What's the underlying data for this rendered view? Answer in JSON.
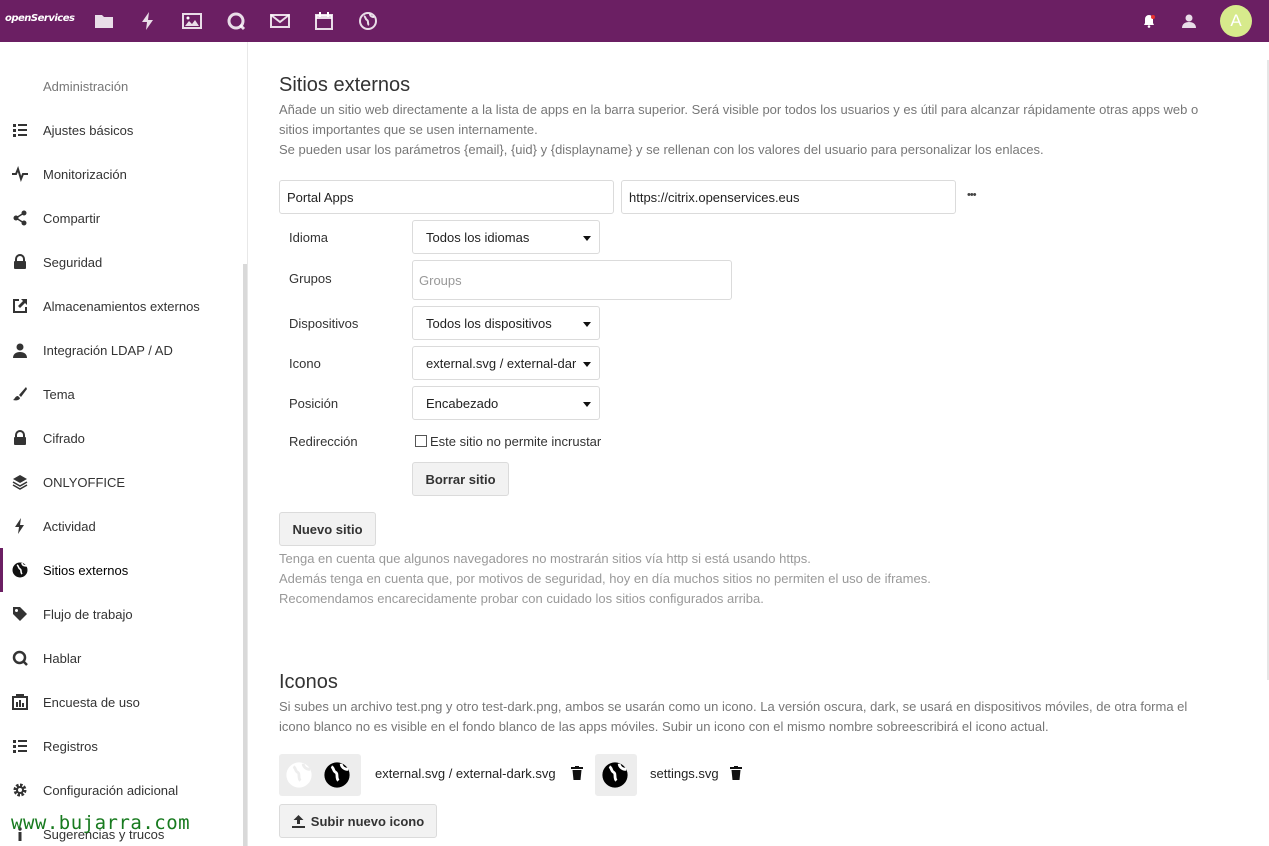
{
  "header": {
    "logo": "openServices",
    "avatar_letter": "A",
    "bg_color": "#6b1f63",
    "apps": [
      {
        "name": "files-icon"
      },
      {
        "name": "activity-icon"
      },
      {
        "name": "gallery-icon"
      },
      {
        "name": "talk-icon"
      },
      {
        "name": "mail-icon"
      },
      {
        "name": "calendar-icon"
      },
      {
        "name": "globe-icon"
      }
    ]
  },
  "sidebar": {
    "heading": "Administración",
    "items": [
      {
        "label": "Ajustes básicos",
        "icon": "list-icon"
      },
      {
        "label": "Monitorización",
        "icon": "pulse-icon"
      },
      {
        "label": "Compartir",
        "icon": "share-icon"
      },
      {
        "label": "Seguridad",
        "icon": "lock-icon"
      },
      {
        "label": "Almacenamientos externos",
        "icon": "external-link-icon"
      },
      {
        "label": "Integración LDAP / AD",
        "icon": "user-icon"
      },
      {
        "label": "Tema",
        "icon": "brush-icon"
      },
      {
        "label": "Cifrado",
        "icon": "lock-icon"
      },
      {
        "label": "ONLYOFFICE",
        "icon": "layers-icon"
      },
      {
        "label": "Actividad",
        "icon": "bolt-icon"
      },
      {
        "label": "Sitios externos",
        "icon": "globe-icon",
        "active": true
      },
      {
        "label": "Flujo de trabajo",
        "icon": "tag-icon"
      },
      {
        "label": "Hablar",
        "icon": "talk-icon"
      },
      {
        "label": "Encuesta de uso",
        "icon": "survey-icon"
      },
      {
        "label": "Registros",
        "icon": "list-icon"
      },
      {
        "label": "Configuración adicional",
        "icon": "gear-icon"
      },
      {
        "label": "Sugerencias y trucos",
        "icon": "info-icon"
      }
    ]
  },
  "external_sites": {
    "title": "Sitios externos",
    "desc_line1": "Añade un sitio web directamente a la lista de apps en la barra superior. Será visible por todos los usuarios y es útil para alcanzar rápidamente otras apps web o",
    "desc_line2": "sitios importantes que se usen internamente.",
    "desc_line3": "Se pueden usar los parámetros {email}, {uid} y {displayname} y se rellenan con los valores del usuario para personalizar los enlaces.",
    "site_name": "Portal Apps",
    "site_url": "https://citrix.openservices.eus",
    "more_label": "•••",
    "labels": {
      "language": "Idioma",
      "groups": "Grupos",
      "devices": "Dispositivos",
      "icon": "Icono",
      "position": "Posición",
      "redirect": "Redirección"
    },
    "language_value": "Todos los idiomas",
    "groups_placeholder": "Groups",
    "devices_value": "Todos los dispositivos",
    "icon_value": "external.svg / external-dark.svg",
    "position_value": "Encabezado",
    "redirect_checkbox_label": "Este sitio no permite incrustar",
    "delete_button": "Borrar sitio",
    "new_site_button": "Nuevo sitio",
    "note_line1": "Tenga en cuenta que algunos navegadores no mostrarán sitios vía http si está usando https.",
    "note_line2": "Además tenga en cuenta que, por motivos de seguridad, hoy en día muchos sitios no permiten el uso de iframes.",
    "note_line3": "Recomendamos encarecidamente probar con cuidado los sitios configurados arriba."
  },
  "icons": {
    "title": "Iconos",
    "desc_line1": "Si subes un archivo test.png y otro test-dark.png, ambos se usarán como un icono. La versión oscura, dark, se usará en dispositivos móviles, de otra forma el",
    "desc_line2": "icono blanco no es visible en el fondo blanco de las apps móviles. Subir un icono con el mismo nombre sobreescribirá el icono actual.",
    "items": [
      {
        "label": "external.svg / external-dark.svg"
      },
      {
        "label": "settings.svg"
      }
    ],
    "upload_button": "Subir nuevo icono"
  },
  "watermark": "www.bujarra.com"
}
